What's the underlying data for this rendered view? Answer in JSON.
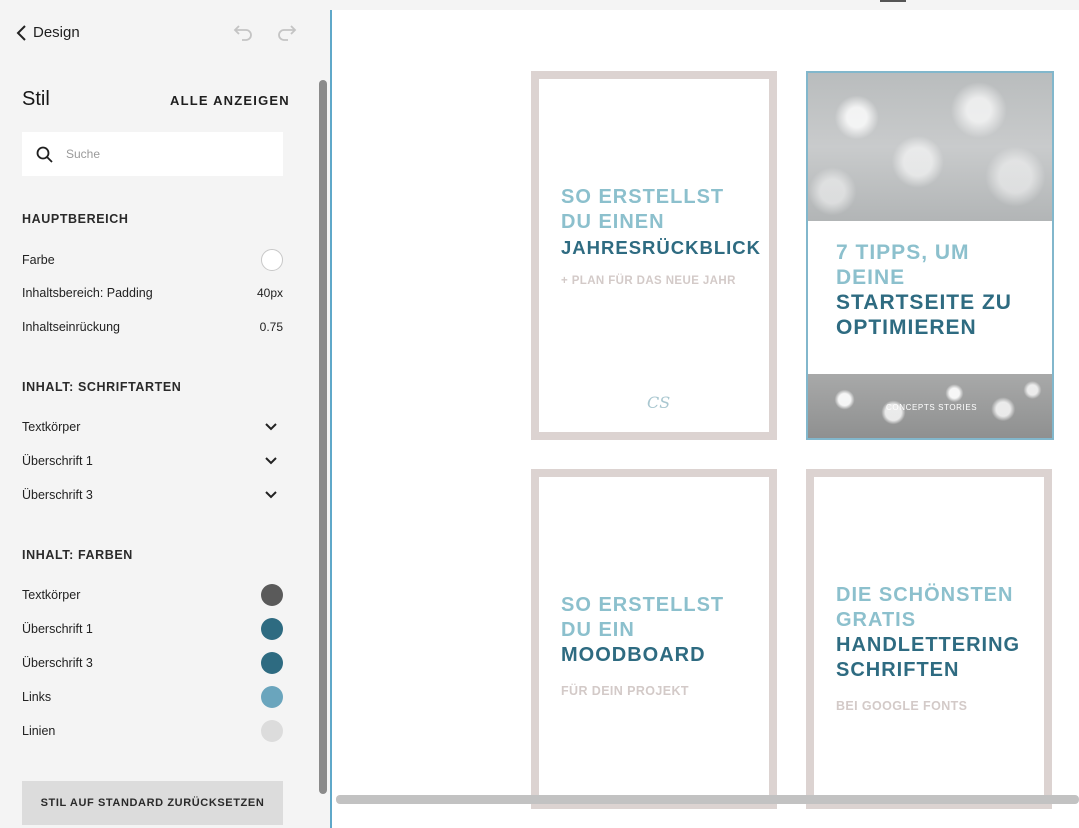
{
  "topbar": {
    "back_label": "Design",
    "undo_icon": "undo-icon",
    "redo_icon": "redo-icon"
  },
  "panel": {
    "title": "Stil",
    "show_all": "ALLE ANZEIGEN",
    "search": {
      "placeholder": "Suche",
      "value": ""
    },
    "sections": {
      "hauptbereich": {
        "heading": "HAUPTBEREICH",
        "farbe": {
          "label": "Farbe",
          "color": "#ffffff"
        },
        "padding": {
          "label": "Inhaltsbereich: Padding",
          "value": "40px"
        },
        "einrueckung": {
          "label": "Inhaltseinrückung",
          "value": "0.75"
        }
      },
      "schriftarten": {
        "heading": "INHALT: SCHRIFTARTEN",
        "items": [
          {
            "label": "Textkörper"
          },
          {
            "label": "Überschrift 1"
          },
          {
            "label": "Überschrift 3"
          }
        ]
      },
      "farben": {
        "heading": "INHALT: FARBEN",
        "items": [
          {
            "label": "Textkörper",
            "color": "#5a5a5a"
          },
          {
            "label": "Überschrift 1",
            "color": "#2e6b81"
          },
          {
            "label": "Überschrift 3",
            "color": "#2e6b81"
          },
          {
            "label": "Links",
            "color": "#6aa5bd"
          },
          {
            "label": "Linien",
            "color": "#dcdcdc"
          }
        ]
      }
    },
    "reset_label": "STIL AUF STANDARD ZURÜCKSETZEN"
  },
  "preview": {
    "cards": [
      {
        "line1": "SO ERSTELLST",
        "line2": "DU EINEN",
        "line3": "JAHRESRÜCKBLICK",
        "sub": "+ PLAN FÜR DAS NEUE JAHR",
        "logo": "CS"
      },
      {
        "line1": "7 TIPPS, UM",
        "line2": "DEINE",
        "line3": "STARTSEITE ZU",
        "line4": "OPTIMIEREN",
        "brand": "CONCEPTS STORIES"
      },
      {
        "line1": "SO ERSTELLST",
        "line2": "DU EIN",
        "line3": "MOODBOARD",
        "sub": "FÜR DEIN PROJEKT"
      },
      {
        "line1": "DIE SCHÖNSTEN",
        "line2": "GRATIS",
        "line3": "HANDLETTERING",
        "line4": "SCHRIFTEN",
        "sub": "BEI GOOGLE FONTS"
      }
    ]
  }
}
